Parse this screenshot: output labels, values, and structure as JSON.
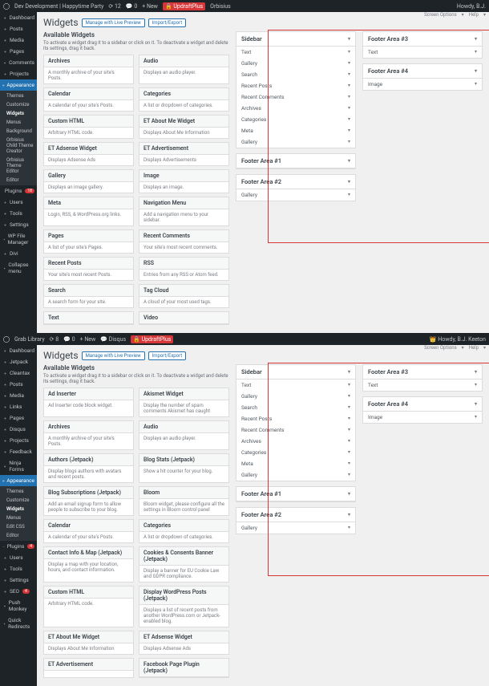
{
  "top1": {
    "site": "Dev Development | Happytime Party",
    "comments": "0",
    "count": "12",
    "new": "+ New",
    "ub": "UpdraftPlus",
    "ort": "Orbisius",
    "howdy": "Howdy, B.J."
  },
  "top2": {
    "lib": "Grab Library",
    "comments": "0",
    "count": "8",
    "new": "+ New",
    "disq": "Disqus",
    "ub": "UpdraftPlus",
    "howdy": "Howdy, B.J. Keeton"
  },
  "screenopts": "Screen Options",
  "help": "Help",
  "menu1": [
    "Dashboard",
    "Posts",
    "Media",
    "Pages",
    "Comments",
    "Projects",
    "Appearance"
  ],
  "sub1": [
    "Themes",
    "Customize",
    "Widgets",
    "Menus",
    "Background",
    "Orbisius Child Theme Creator",
    "Orbisius Theme Editor",
    "Editor"
  ],
  "menu1b": [
    [
      "Plugins",
      "18"
    ],
    [
      "Users",
      ""
    ],
    [
      "Tools",
      ""
    ],
    [
      "Settings",
      ""
    ],
    [
      "WP File Manager",
      ""
    ],
    [
      "Divi",
      ""
    ],
    [
      "Collapse menu",
      ""
    ]
  ],
  "menu2": [
    "Dashboard",
    "Jetpack",
    "Cleantax",
    "Posts",
    "Media",
    "Links",
    "Pages",
    "Disqus",
    "Projects",
    "Feedback",
    "Ninja Forms",
    "Appearance"
  ],
  "sub2": [
    "Themes",
    "Customize",
    "Widgets",
    "Menus",
    "Edit CSS",
    "Editor"
  ],
  "menu2b": [
    [
      "Plugins",
      "4"
    ],
    [
      "Users",
      ""
    ],
    [
      "Tools",
      ""
    ],
    [
      "Settings",
      ""
    ],
    [
      "SEO",
      "4"
    ],
    [
      "Push Monkey",
      ""
    ],
    [
      "Quick Redirects",
      ""
    ]
  ],
  "title": "Widgets",
  "btn1": "Manage with Live Preview",
  "btn2": "Import/Export",
  "avail": "Available Widgets",
  "availdesc": "To activate a widget drag it to a sidebar or click on it. To deactivate a widget and delete its settings, drag it back.",
  "w1": [
    [
      "Archives",
      "A monthly archive of your site's Posts.",
      "Audio",
      "Displays an audio player."
    ],
    [
      "Calendar",
      "A calendar of your site's Posts.",
      "Categories",
      "A list or dropdown of categories."
    ],
    [
      "Custom HTML",
      "Arbitrary HTML code.",
      "ET About Me Widget",
      "Displays About Me Information"
    ],
    [
      "ET Adsense Widget",
      "Displays Adsense Ads",
      "ET Advertisement",
      "Displays Advertisements"
    ],
    [
      "Gallery",
      "Displays an image gallery.",
      "Image",
      "Displays an image."
    ],
    [
      "Meta",
      "Login, RSS, & WordPress.org links.",
      "Navigation Menu",
      "Add a navigation menu to your sidebar."
    ],
    [
      "Pages",
      "A list of your site's Pages.",
      "Recent Comments",
      "Your site's most recent comments."
    ],
    [
      "Recent Posts",
      "Your site's most recent Posts.",
      "RSS",
      "Entries from any RSS or Atom feed."
    ],
    [
      "Search",
      "A search form for your site.",
      "Tag Cloud",
      "A cloud of your most used tags."
    ],
    [
      "Text",
      "",
      "Video",
      ""
    ]
  ],
  "w2": [
    [
      "Ad Inserter",
      "Ad Inserter code block widget.",
      "Akismet Widget",
      "Display the number of spam comments Akismet has caught"
    ],
    [
      "Archives",
      "A monthly archive of your site's Posts.",
      "Audio",
      "Displays an audio player."
    ],
    [
      "Authors (Jetpack)",
      "Display blogs authors with avatars and recent posts.",
      "Blog Stats (Jetpack)",
      "Show a hit counter for your blog."
    ],
    [
      "Blog Subscriptions (Jetpack)",
      "Add an email signup form to allow people to subscribe to your blog.",
      "Bloom",
      "Bloom widget, please configure all the settings in Bloom control panel"
    ],
    [
      "Calendar",
      "A calendar of your site's Posts.",
      "Categories",
      "A list or dropdown of categories."
    ],
    [
      "Contact Info & Map (Jetpack)",
      "Display a map with your location, hours, and contact information.",
      "Cookies & Consents Banner (Jetpack)",
      "Display a banner for EU Cookie Law and GDPR compliance."
    ],
    [
      "Custom HTML",
      "Arbitrary HTML code.",
      "Display WordPress Posts (Jetpack)",
      "Displays a list of recent posts from another WordPress.com or Jetpack-enabled blog."
    ],
    [
      "ET About Me Widget",
      "Displays About Me Information",
      "ET Adsense Widget",
      "Displays Adsense Ads"
    ],
    [
      "ET Advertisement",
      "",
      "Facebook Page Plugin (Jetpack)",
      ""
    ]
  ],
  "sb": {
    "title": "Sidebar",
    "items": [
      "Text",
      "Gallery",
      "Search",
      "Recent Posts",
      "Recent Comments",
      "Archives",
      "Categories",
      "Meta",
      "Gallery"
    ]
  },
  "fa1": {
    "title": "Footer Area #1"
  },
  "fa2": {
    "title": "Footer Area #2",
    "items": [
      "Gallery"
    ]
  },
  "fa3": {
    "title": "Footer Area #3",
    "items": [
      "Text"
    ]
  },
  "fa4": {
    "title": "Footer Area #4",
    "items": [
      "Image"
    ]
  }
}
